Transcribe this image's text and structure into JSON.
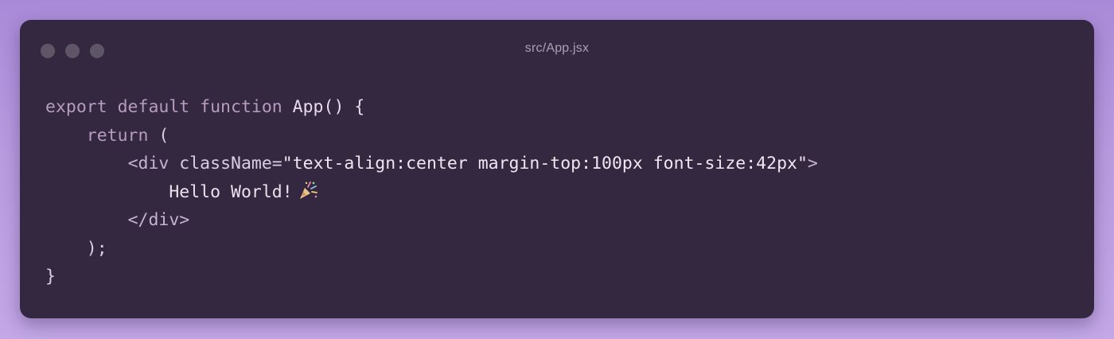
{
  "window": {
    "title": "src/App.jsx",
    "traffic_lights": [
      "close",
      "minimize",
      "maximize"
    ]
  },
  "code": {
    "language": "jsx",
    "lines": [
      {
        "tokens": [
          {
            "type": "kw",
            "text": "export default function "
          },
          {
            "type": "pl",
            "text": "App() {"
          }
        ]
      },
      {
        "tokens": [
          {
            "type": "ws",
            "text": "    "
          },
          {
            "type": "kw",
            "text": "return "
          },
          {
            "type": "pn",
            "text": "("
          }
        ]
      },
      {
        "tokens": [
          {
            "type": "ws",
            "text": "        "
          },
          {
            "type": "tag",
            "text": "<div "
          },
          {
            "type": "attr",
            "text": "className="
          },
          {
            "type": "str",
            "text": "\"text-align:center margin-top:100px font-size:42px\""
          },
          {
            "type": "tag",
            "text": ">"
          }
        ]
      },
      {
        "tokens": [
          {
            "type": "ws",
            "text": "            "
          },
          {
            "type": "txt",
            "text": "Hello World!"
          }
        ],
        "icon": "party-popper-icon"
      },
      {
        "tokens": [
          {
            "type": "ws",
            "text": "        "
          },
          {
            "type": "tag",
            "text": "</div>"
          }
        ]
      },
      {
        "tokens": [
          {
            "type": "ws",
            "text": "    "
          },
          {
            "type": "pn",
            "text": ");"
          }
        ]
      },
      {
        "tokens": [
          {
            "type": "pn",
            "text": "}"
          }
        ]
      }
    ]
  },
  "colors": {
    "background_gradient": [
      "#a98ad8",
      "#c3a7e6"
    ],
    "window_bg": "#332840",
    "dot": "#5e5566",
    "title_text": "#aaa1b3",
    "keyword": "#b79bc0",
    "plain": "#e8dcec"
  }
}
